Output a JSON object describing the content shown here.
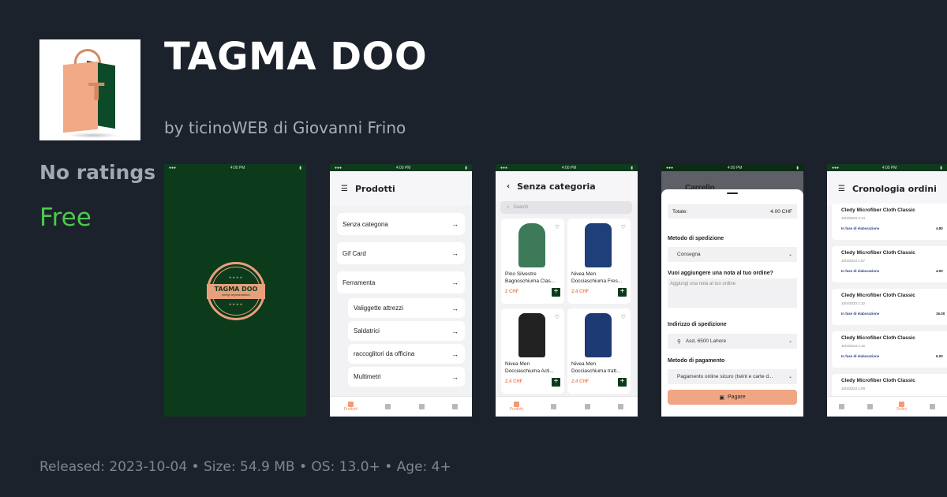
{
  "app": {
    "title": "TAGMA DOO",
    "developer": "by ticinoWEB di Giovanni Frino",
    "ratings": "No ratings",
    "price": "Free",
    "icon_letter": "T",
    "footer": "Released: 2023-10-04 • Size: 54.9 MB • OS: 13.0+ • Age: 4+"
  },
  "colors": {
    "background": "#1c222b",
    "price_green": "#4cc850",
    "brand_green": "#0c3b1c",
    "accent_peach": "#f0a584"
  },
  "screens": {
    "splash": {
      "badge_title": "TAGMA DOO",
      "badge_subtitle": "foreign representatives",
      "badge_stars": "★★★★"
    },
    "products": {
      "title": "Prodotti",
      "categories": [
        "Senza categoria",
        "Gif Card",
        "Ferramenta"
      ],
      "subcategories": [
        "Valiggette attrezzi",
        "Saldatrici",
        "raccoglitori da officina",
        "Multimetri"
      ],
      "nav": [
        "Prodotti"
      ]
    },
    "category": {
      "title": "Senza categoria",
      "search_placeholder": "Search",
      "products": [
        {
          "name": "Pino Silvestre Bagnoschiuma Clas...",
          "price": "2 CHF"
        },
        {
          "name": "Nivea Men Docciaschiuma Fres...",
          "price": "2.4 CHF"
        },
        {
          "name": "Nivea Men Docciaschiuma Acti...",
          "price": "2.4 CHF"
        },
        {
          "name": "Nivea Men Docciaschiuma tratt...",
          "price": "2.4 CHF"
        }
      ],
      "nav": [
        "Prodotti"
      ]
    },
    "cart": {
      "title_behind": "Carrello",
      "total_label": "Totale:",
      "total_value": "4.00 CHF",
      "shipping_method_label": "Metodo di spedizione",
      "shipping_method_value": "Consegna",
      "note_label": "Vuoi aggiungere una nota al tuo ordine?",
      "note_placeholder": "Aggiungi una nota al tuo ordine",
      "address_label": "Indirizzo di spedizione",
      "address_value": "Asd, 6500 Lahore",
      "payment_label": "Metodo di pagamento",
      "payment_value": "Pagamento online sicuro (twint e carte d...",
      "pay_button": "Pagare"
    },
    "orders": {
      "title": "Cronologia ordini",
      "orders": [
        {
          "name": "Cledy Microfiber Cloth Classic",
          "date": "10/4/2023 2:14",
          "status": "In fase di elaborazione",
          "total": "4.80"
        },
        {
          "name": "Cledy Microfiber Cloth Classic",
          "date": "10/4/2023 1:57",
          "status": "In fase di elaborazione",
          "total": "4.00"
        },
        {
          "name": "Cledy Microfiber Cloth Classic",
          "date": "10/4/2023 1:12",
          "status": "In fase di elaborazione",
          "total": "16.00"
        },
        {
          "name": "Cledy Microfiber Cloth Classic",
          "date": "10/4/2023 1:12",
          "status": "In fase di elaborazione",
          "total": "6.00"
        },
        {
          "name": "Cledy Microfiber Cloth Classic",
          "date": "10/4/2023 1:09",
          "status": "",
          "total": ""
        }
      ],
      "nav": [
        "Ordini"
      ]
    }
  }
}
